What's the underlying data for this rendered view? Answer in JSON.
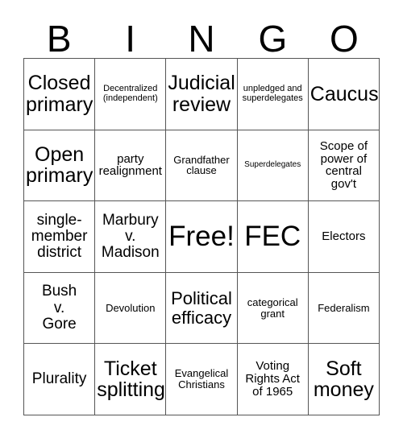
{
  "card": {
    "title": "BINGO",
    "header_letters": [
      "B",
      "I",
      "N",
      "G",
      "O"
    ],
    "free_space_label": "Free!",
    "grid_size": "5x5",
    "line_color": "#555555",
    "text_color": "#000000",
    "background_color": "#ffffff",
    "cells": [
      {
        "text": "Closed\nprimary",
        "size": "fs-xl"
      },
      {
        "text": "Decentralized\n(independent)",
        "size": "fs-xxs"
      },
      {
        "text": "Judicial\nreview",
        "size": "fs-xl"
      },
      {
        "text": "unpledged and\nsuperdelegates",
        "size": "fs-xxs"
      },
      {
        "text": "Caucus",
        "size": "fs-xl"
      },
      {
        "text": "Open\nprimary",
        "size": "fs-xl"
      },
      {
        "text": "party\nrealignment",
        "size": "fs-sm"
      },
      {
        "text": "Grandfather\nclause",
        "size": "fs-xs"
      },
      {
        "text": "Superdelegates",
        "size": "fs-tny"
      },
      {
        "text": "Scope of\npower of\ncentral\ngov't",
        "size": "fs-sm"
      },
      {
        "text": "single-\nmember\ndistrict",
        "size": "fs-md"
      },
      {
        "text": "Marbury\nv.\nMadison",
        "size": "fs-md"
      },
      {
        "text": "Free!",
        "size": "fs-xxl"
      },
      {
        "text": "FEC",
        "size": "fs-xxl"
      },
      {
        "text": "Electors",
        "size": "fs-sm"
      },
      {
        "text": "Bush\nv.\nGore",
        "size": "fs-md"
      },
      {
        "text": "Devolution",
        "size": "fs-xs"
      },
      {
        "text": "Political\nefficacy",
        "size": "fs-lg"
      },
      {
        "text": "categorical\ngrant",
        "size": "fs-xs"
      },
      {
        "text": "Federalism",
        "size": "fs-xs"
      },
      {
        "text": "Plurality",
        "size": "fs-md"
      },
      {
        "text": "Ticket\nsplitting",
        "size": "fs-xl"
      },
      {
        "text": "Evangelical\nChristians",
        "size": "fs-xs"
      },
      {
        "text": "Voting\nRights Act\nof 1965",
        "size": "fs-sm"
      },
      {
        "text": "Soft\nmoney",
        "size": "fs-xl"
      }
    ]
  }
}
